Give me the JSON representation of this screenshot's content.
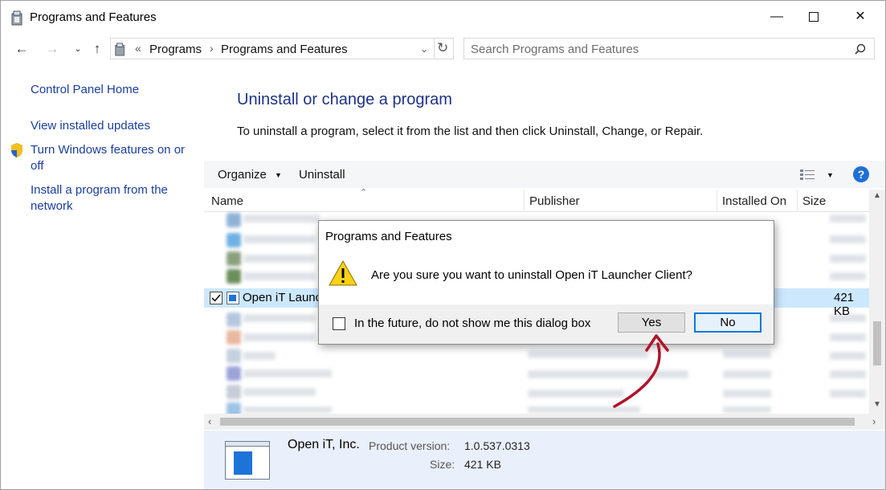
{
  "window": {
    "title": "Programs and Features"
  },
  "address": {
    "overflow": "«",
    "crumbs": [
      "Programs",
      "Programs and Features"
    ],
    "search_placeholder": "Search Programs and Features"
  },
  "left_pane": {
    "home": "Control Panel Home",
    "updates": "View installed updates",
    "features": "Turn Windows features on or off",
    "install": "Install a program from the network"
  },
  "main": {
    "heading": "Uninstall or change a program",
    "description": "To uninstall a program, select it from the list and then click Uninstall, Change, or Repair.",
    "toolbar": {
      "organize": "Organize",
      "uninstall": "Uninstall"
    },
    "columns": {
      "name": "Name",
      "publisher": "Publisher",
      "installed_on": "Installed On",
      "size": "Size"
    },
    "selected_row": {
      "name": "Open iT Launc",
      "size": "421 KB"
    }
  },
  "details": {
    "publisher": "Open iT, Inc.",
    "version_label": "Product version:",
    "version": "1.0.537.0313",
    "size_label": "Size:",
    "size": "421 KB"
  },
  "dialog": {
    "title": "Programs and Features",
    "message": "Are you sure you want to uninstall Open iT Launcher Client?",
    "checkbox_label": "In the future, do not show me this dialog box",
    "yes": "Yes",
    "no": "No"
  },
  "colors": {
    "accent": "#1e3287",
    "link": "#1a3e9c",
    "selection": "#cce8ff",
    "annotation_arrow": "#b0142a"
  }
}
